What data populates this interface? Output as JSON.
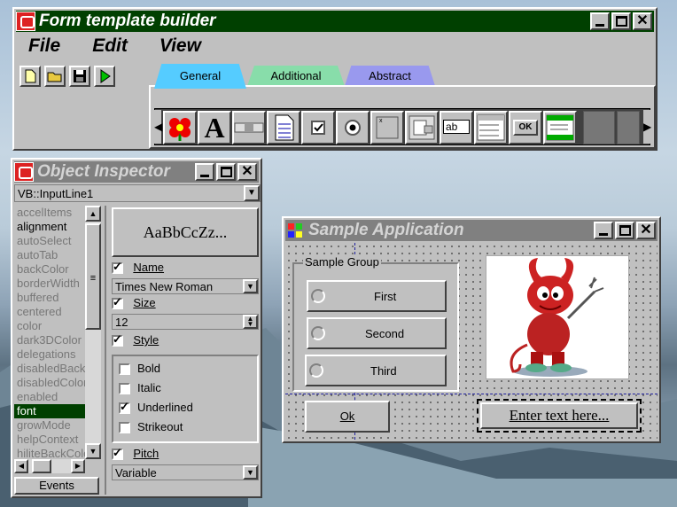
{
  "builder": {
    "title": "Form template builder",
    "menu": [
      "File",
      "Edit",
      "View"
    ],
    "tabs": [
      "General",
      "Additional",
      "Abstract"
    ],
    "tab_colors": [
      "#55ccff",
      "#88ddaa",
      "#9999ee"
    ],
    "palette_icons": [
      "flower-icon",
      "text-a-icon",
      "scrollbar-icon",
      "document-icon",
      "checkbox-icon",
      "radio-icon",
      "blank-icon",
      "group-icon",
      "inputline-icon",
      "listbox-icon",
      "ok-button-icon",
      "outline-icon"
    ],
    "ok_icon_label": "OK",
    "inputline_icon_label": "ab"
  },
  "inspector": {
    "title": "Object Inspector",
    "selector": "VB::InputLine1",
    "properties": [
      "accelItems",
      "alignment",
      "autoSelect",
      "autoTab",
      "backColor",
      "borderWidth",
      "buffered",
      "centered",
      "color",
      "dark3DColor",
      "delegations",
      "disabledBackColor",
      "disabledColor",
      "enabled",
      "font",
      "growMode",
      "helpContext",
      "hiliteBackColor"
    ],
    "selected_property": "font",
    "events_label": "Events",
    "preview": "AaBbCcZz...",
    "name_label": "Name",
    "font_name": "Times New Roman",
    "size_label": "Size",
    "size_value": "12",
    "style_label": "Style",
    "styles": [
      {
        "label": "Bold",
        "checked": false
      },
      {
        "label": "Italic",
        "checked": false
      },
      {
        "label": "Underlined",
        "checked": true
      },
      {
        "label": "Strikeout",
        "checked": false
      }
    ],
    "pitch_label": "Pitch",
    "pitch_value": "Variable"
  },
  "sample": {
    "title": "Sample Application",
    "group_label": "Sample Group",
    "radios": [
      "First",
      "Second",
      "Third"
    ],
    "ok_label": "Ok",
    "input_text": "Enter text here..."
  }
}
